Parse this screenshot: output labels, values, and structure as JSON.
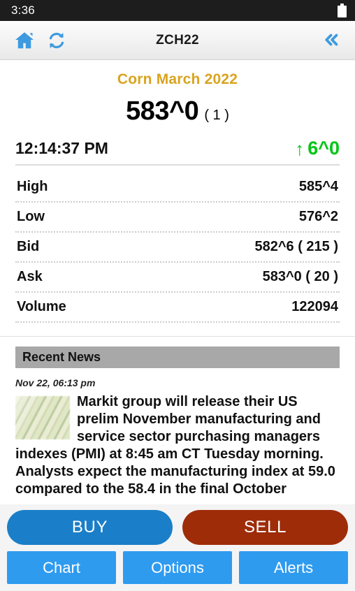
{
  "status_bar": {
    "time": "3:36",
    "battery_icon": "battery-full-icon"
  },
  "navbar": {
    "home_icon": "home-icon",
    "refresh_icon": "refresh-icon",
    "title": "ZCH22",
    "back_icon": "double-chevron-left-icon"
  },
  "quote": {
    "contract_name": "Corn March 2022",
    "last_price": "583^0",
    "last_size": "( 1 )",
    "time": "12:14:37 PM",
    "change_arrow": "↑",
    "change": "6^0",
    "change_color": "#00c514",
    "contract_name_color": "#d9a41e",
    "rows": [
      {
        "label": "High",
        "value": "585^4"
      },
      {
        "label": "Low",
        "value": "576^2"
      },
      {
        "label": "Bid",
        "value": "582^6 ( 215 )"
      },
      {
        "label": "Ask",
        "value": "583^0 ( 20 )"
      },
      {
        "label": "Volume",
        "value": "122094"
      }
    ]
  },
  "news": {
    "header": "Recent News",
    "date": "Nov 22, 06:13 pm",
    "thumbnail_icon": "cash-photo-thumbnail",
    "body": "Markit group will release their US prelim November manufacturing and service sector purchasing managers indexes (PMI) at 8:45 am CT Tuesday morning. Analysts expect the manufacturing index at 59.0 compared to the 58.4 in the final October"
  },
  "actions": {
    "buy_label": "BUY",
    "sell_label": "SELL",
    "buy_color": "#1a7fc8",
    "sell_color": "#9e2c09",
    "secondary": [
      {
        "label": "Chart"
      },
      {
        "label": "Options"
      },
      {
        "label": "Alerts"
      }
    ]
  }
}
